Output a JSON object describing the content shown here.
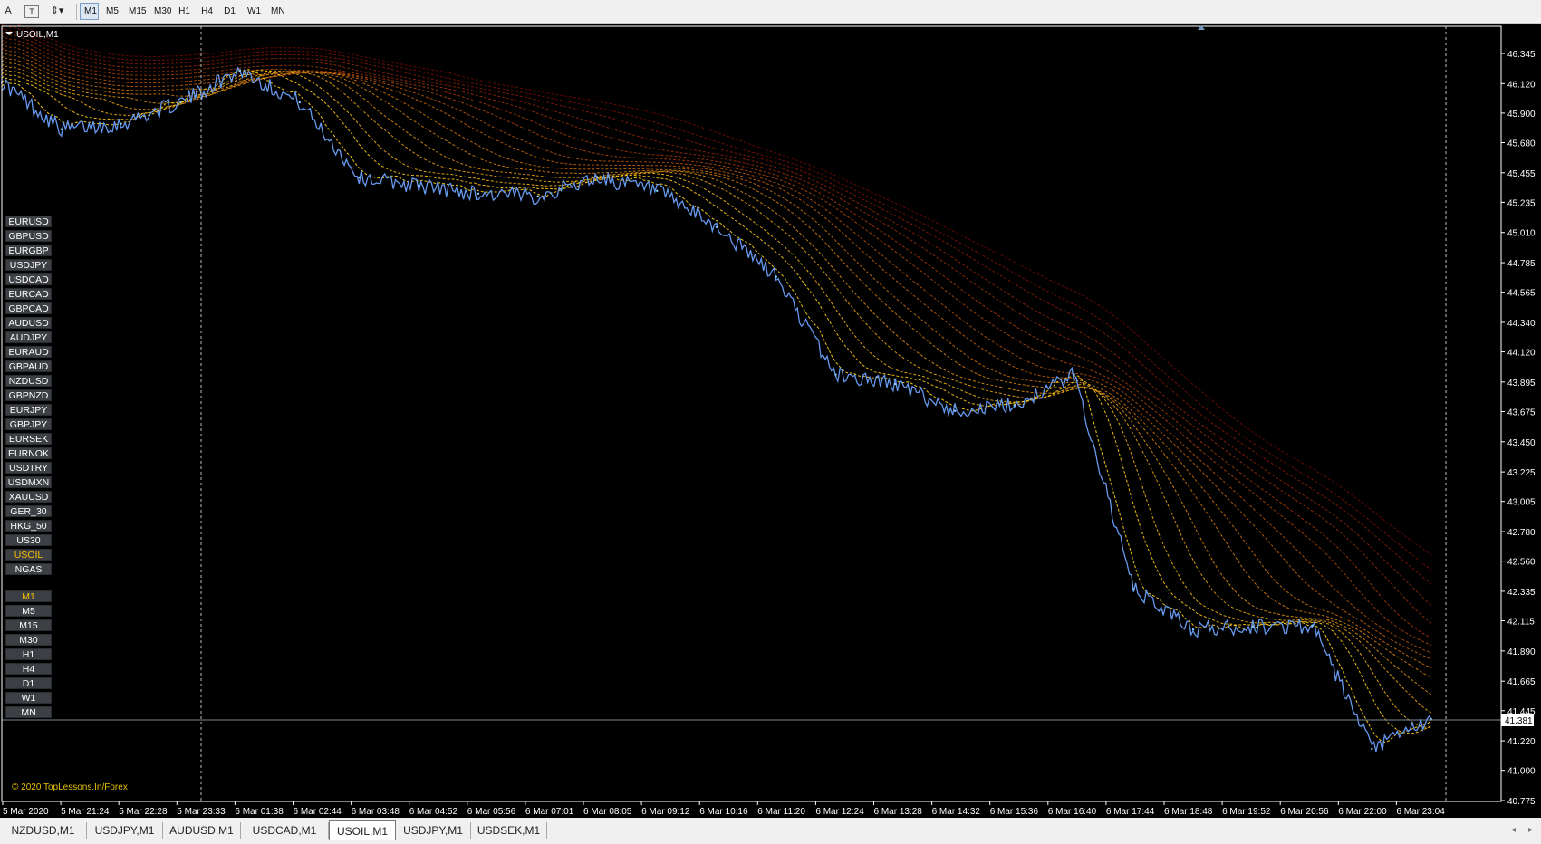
{
  "toolbar": {
    "text_tool_label": "A",
    "text_label_tool_label": "T",
    "timeframes": [
      "M1",
      "M5",
      "M15",
      "M30",
      "H1",
      "H4",
      "D1",
      "W1",
      "MN"
    ],
    "active_timeframe": "M1"
  },
  "chart": {
    "title": "USOIL,M1",
    "current_price": "41.381",
    "copyright": "© 2020 TopLessons.In/Forex",
    "colors": {
      "background": "#000000",
      "price_line": "#6699ee",
      "axis_text": "#ffffff",
      "ribbon_fast": "#ffd21e",
      "ribbon_slow": "#dc140a",
      "current_price_line": "#778899"
    }
  },
  "symbols": [
    "EURUSD",
    "GBPUSD",
    "EURGBP",
    "USDJPY",
    "USDCAD",
    "EURCAD",
    "GBPCAD",
    "AUDUSD",
    "AUDJPY",
    "EURAUD",
    "GBPAUD",
    "NZDUSD",
    "GBPNZD",
    "EURJPY",
    "GBPJPY",
    "EURSEK",
    "EURNOK",
    "USDTRY",
    "USDMXN",
    "XAUUSD",
    "GER_30",
    "HKG_50",
    "US30",
    "USOIL",
    "NGAS"
  ],
  "active_symbol": "USOIL",
  "timeframe_buttons": [
    "M1",
    "M5",
    "M15",
    "M30",
    "H1",
    "H4",
    "D1",
    "W1",
    "MN"
  ],
  "active_timeframe_button": "M1",
  "tabs": [
    "NZDUSD,M1",
    "USDJPY,M1",
    "AUDUSD,M1",
    "USDCAD,M1",
    "USOIL,M1",
    "USDJPY,M1",
    "USDSEK,M1"
  ],
  "active_tab": "USOIL,M1",
  "chart_data": {
    "type": "line",
    "title": "USOIL,M1",
    "x_tick_labels": [
      "5 Mar 2020",
      "5 Mar 21:24",
      "5 Mar 22:28",
      "5 Mar 23:33",
      "6 Mar 01:38",
      "6 Mar 02:44",
      "6 Mar 03:48",
      "6 Mar 04:52",
      "6 Mar 05:56",
      "6 Mar 07:01",
      "6 Mar 08:05",
      "6 Mar 09:12",
      "6 Mar 10:16",
      "6 Mar 11:20",
      "6 Mar 12:24",
      "6 Mar 13:28",
      "6 Mar 14:32",
      "6 Mar 15:36",
      "6 Mar 16:40",
      "6 Mar 17:44",
      "6 Mar 18:48",
      "6 Mar 19:52",
      "6 Mar 20:56",
      "6 Mar 22:00",
      "6 Mar 23:04"
    ],
    "y_tick_labels": [
      "46.345",
      "46.120",
      "45.900",
      "45.680",
      "45.455",
      "45.235",
      "45.010",
      "44.785",
      "44.565",
      "44.340",
      "44.120",
      "43.895",
      "43.675",
      "43.450",
      "43.225",
      "43.005",
      "42.780",
      "42.560",
      "42.335",
      "42.115",
      "41.890",
      "41.665",
      "41.445",
      "41.220",
      "41.000",
      "40.775"
    ],
    "ylim": [
      40.775,
      46.345
    ],
    "series": [
      {
        "x": [
          0,
          1,
          2,
          3,
          4,
          5,
          6,
          7,
          8,
          9,
          10,
          11,
          12,
          13,
          14,
          15,
          16,
          17,
          18,
          19,
          20,
          21,
          22,
          23,
          24
        ],
        "values": [
          46.13,
          45.78,
          45.82,
          45.98,
          46.22,
          45.98,
          45.42,
          45.36,
          45.3,
          45.28,
          45.42,
          45.32,
          45.05,
          44.68,
          43.95,
          43.88,
          43.68,
          43.72,
          43.95,
          42.35,
          42.05,
          42.07,
          42.08,
          41.16,
          41.38
        ]
      }
    ]
  }
}
